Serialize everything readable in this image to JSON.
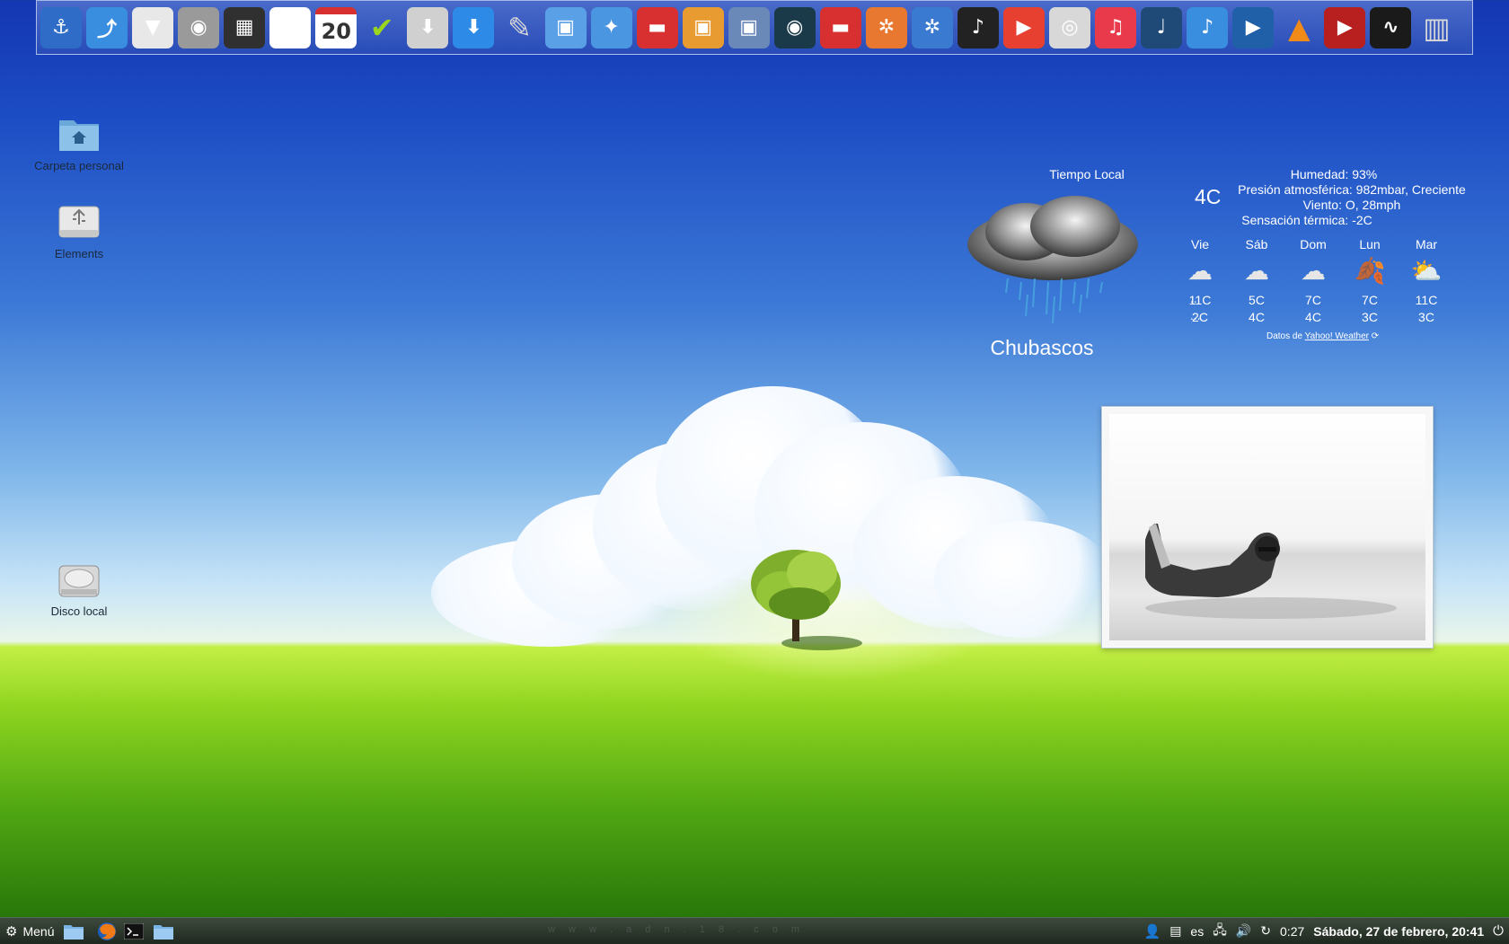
{
  "dock": {
    "items": [
      {
        "icon": "anchor-icon",
        "glyph": "⚓",
        "bg": "#2f6cc8"
      },
      {
        "icon": "dolphin-file-manager-icon",
        "glyph": "⤴",
        "bg": "#3a8ee0"
      },
      {
        "icon": "tie-icon",
        "glyph": "▼",
        "bg": "#e8e8e8"
      },
      {
        "icon": "camera-icon",
        "glyph": "◉",
        "bg": "#9a9a9a"
      },
      {
        "icon": "calculator-icon",
        "glyph": "▦",
        "bg": "#303030"
      },
      {
        "icon": "color-picker-icon",
        "glyph": "◍",
        "bg": "#ffffff"
      },
      {
        "icon": "calendar-icon",
        "glyph": "",
        "bg": "#ffffff",
        "text": "20"
      },
      {
        "icon": "checkmark-icon",
        "glyph": "✔",
        "bg": "rgba(0,0,0,0)"
      },
      {
        "icon": "installer-icon",
        "glyph": "⬇",
        "bg": "#d0d0d0"
      },
      {
        "icon": "download-icon",
        "glyph": "⬇",
        "bg": "#2d8ae6"
      },
      {
        "icon": "paint-brush-icon",
        "glyph": "✎",
        "bg": "rgba(0,0,0,0)"
      },
      {
        "icon": "photo-viewer-icon",
        "glyph": "▣",
        "bg": "#5aa0e6"
      },
      {
        "icon": "screensaver-icon",
        "glyph": "✦",
        "bg": "#4a96e0"
      },
      {
        "icon": "wallpaper-icon",
        "glyph": "▬",
        "bg": "#d83030"
      },
      {
        "icon": "image-gallery-icon",
        "glyph": "▣",
        "bg": "#e89b30"
      },
      {
        "icon": "photo-manager-icon",
        "glyph": "▣",
        "bg": "#6a88b8"
      },
      {
        "icon": "eye-icon",
        "glyph": "◉",
        "bg": "#1a3a4a"
      },
      {
        "icon": "photo-editor-icon",
        "glyph": "▬",
        "bg": "#d83030"
      },
      {
        "icon": "image-settings-icon",
        "glyph": "✲",
        "bg": "#e87830"
      },
      {
        "icon": "image-tool-icon",
        "glyph": "✲",
        "bg": "#3a7ad0"
      },
      {
        "icon": "music-player-icon",
        "glyph": "♪",
        "bg": "#222222"
      },
      {
        "icon": "video-player-icon",
        "glyph": "▶",
        "bg": "#e84030"
      },
      {
        "icon": "cd-burner-icon",
        "glyph": "◎",
        "bg": "#d8d8d8"
      },
      {
        "icon": "itunes-icon",
        "glyph": "♫",
        "bg": "#e83a4a"
      },
      {
        "icon": "audio-app-icon",
        "glyph": "♩",
        "bg": "#1f4a78"
      },
      {
        "icon": "music-note-icon",
        "glyph": "♪",
        "bg": "#3a8ee0"
      },
      {
        "icon": "media-play-icon",
        "glyph": "▶",
        "bg": "#2060a8"
      },
      {
        "icon": "vlc-icon",
        "glyph": "▲",
        "bg": "rgba(0,0,0,0)"
      },
      {
        "icon": "film-strip-icon",
        "glyph": "▶",
        "bg": "#b82020"
      },
      {
        "icon": "system-monitor-icon",
        "glyph": "∿",
        "bg": "#1a1a1a"
      },
      {
        "icon": "trash-icon",
        "glyph": "▥",
        "bg": "rgba(0,0,0,0)"
      }
    ]
  },
  "desktop": {
    "icons": [
      {
        "label": "Carpeta personal",
        "icon": "home-folder-icon"
      },
      {
        "label": "Elements",
        "icon": "usb-drive-icon"
      },
      {
        "label": "Disco local",
        "icon": "hard-disk-icon"
      }
    ]
  },
  "weather": {
    "title": "Tiempo Local",
    "condition": "Chubascos",
    "current_temp": "4C",
    "humidity": "Humedad: 93%",
    "pressure": "Presión atmosférica: 982mbar, Creciente",
    "wind": "Viento: O, 28mph",
    "feels_like": "Sensación térmica: -2C",
    "forecast": [
      {
        "day": "Vie",
        "high": "11C",
        "low": "2C",
        "icon": "cloud-icon"
      },
      {
        "day": "Sáb",
        "high": "5C",
        "low": "4C",
        "icon": "cloud-icon"
      },
      {
        "day": "Dom",
        "high": "7C",
        "low": "4C",
        "icon": "cloud-icon"
      },
      {
        "day": "Lun",
        "high": "7C",
        "low": "3C",
        "icon": "windy-leaves-icon"
      },
      {
        "day": "Mar",
        "high": "11C",
        "low": "3C",
        "icon": "partly-sunny-icon"
      }
    ],
    "row_dots": "...",
    "credit_prefix": "Datos de",
    "credit_link": "Yahoo! Weather"
  },
  "taskbar": {
    "menu_label": "Menú",
    "language": "es",
    "battery": "0:27",
    "datetime": "Sábado, 27 de febrero, 20:41",
    "watermark": "w w w . a d n . 1 8 . c o m"
  },
  "colors": {
    "sky_top": "#1436b3",
    "grass": "#8fd520",
    "taskbar_bg": "#2c362c"
  }
}
